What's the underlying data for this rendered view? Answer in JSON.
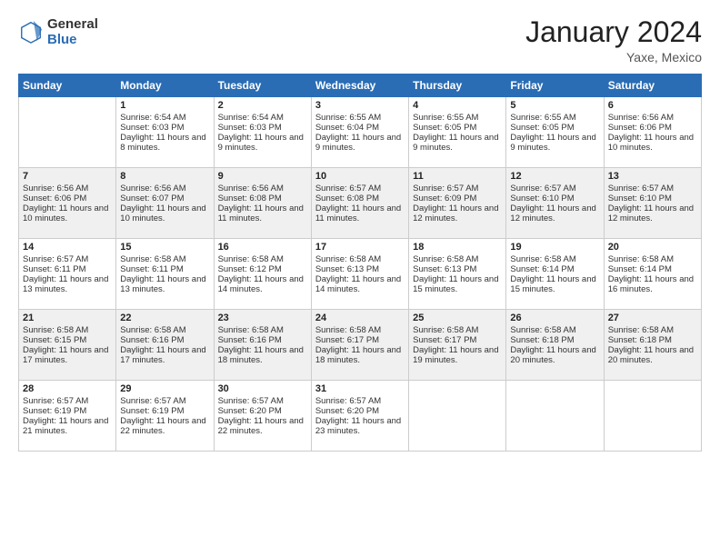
{
  "logo": {
    "general": "General",
    "blue": "Blue"
  },
  "title": "January 2024",
  "location": "Yaxe, Mexico",
  "days_header": [
    "Sunday",
    "Monday",
    "Tuesday",
    "Wednesday",
    "Thursday",
    "Friday",
    "Saturday"
  ],
  "weeks": [
    [
      {
        "day": "",
        "data": ""
      },
      {
        "day": "1",
        "sunrise": "Sunrise: 6:54 AM",
        "sunset": "Sunset: 6:03 PM",
        "daylight": "Daylight: 11 hours and 8 minutes."
      },
      {
        "day": "2",
        "sunrise": "Sunrise: 6:54 AM",
        "sunset": "Sunset: 6:03 PM",
        "daylight": "Daylight: 11 hours and 9 minutes."
      },
      {
        "day": "3",
        "sunrise": "Sunrise: 6:55 AM",
        "sunset": "Sunset: 6:04 PM",
        "daylight": "Daylight: 11 hours and 9 minutes."
      },
      {
        "day": "4",
        "sunrise": "Sunrise: 6:55 AM",
        "sunset": "Sunset: 6:05 PM",
        "daylight": "Daylight: 11 hours and 9 minutes."
      },
      {
        "day": "5",
        "sunrise": "Sunrise: 6:55 AM",
        "sunset": "Sunset: 6:05 PM",
        "daylight": "Daylight: 11 hours and 9 minutes."
      },
      {
        "day": "6",
        "sunrise": "Sunrise: 6:56 AM",
        "sunset": "Sunset: 6:06 PM",
        "daylight": "Daylight: 11 hours and 10 minutes."
      }
    ],
    [
      {
        "day": "7",
        "sunrise": "Sunrise: 6:56 AM",
        "sunset": "Sunset: 6:06 PM",
        "daylight": "Daylight: 11 hours and 10 minutes."
      },
      {
        "day": "8",
        "sunrise": "Sunrise: 6:56 AM",
        "sunset": "Sunset: 6:07 PM",
        "daylight": "Daylight: 11 hours and 10 minutes."
      },
      {
        "day": "9",
        "sunrise": "Sunrise: 6:56 AM",
        "sunset": "Sunset: 6:08 PM",
        "daylight": "Daylight: 11 hours and 11 minutes."
      },
      {
        "day": "10",
        "sunrise": "Sunrise: 6:57 AM",
        "sunset": "Sunset: 6:08 PM",
        "daylight": "Daylight: 11 hours and 11 minutes."
      },
      {
        "day": "11",
        "sunrise": "Sunrise: 6:57 AM",
        "sunset": "Sunset: 6:09 PM",
        "daylight": "Daylight: 11 hours and 12 minutes."
      },
      {
        "day": "12",
        "sunrise": "Sunrise: 6:57 AM",
        "sunset": "Sunset: 6:10 PM",
        "daylight": "Daylight: 11 hours and 12 minutes."
      },
      {
        "day": "13",
        "sunrise": "Sunrise: 6:57 AM",
        "sunset": "Sunset: 6:10 PM",
        "daylight": "Daylight: 11 hours and 12 minutes."
      }
    ],
    [
      {
        "day": "14",
        "sunrise": "Sunrise: 6:57 AM",
        "sunset": "Sunset: 6:11 PM",
        "daylight": "Daylight: 11 hours and 13 minutes."
      },
      {
        "day": "15",
        "sunrise": "Sunrise: 6:58 AM",
        "sunset": "Sunset: 6:11 PM",
        "daylight": "Daylight: 11 hours and 13 minutes."
      },
      {
        "day": "16",
        "sunrise": "Sunrise: 6:58 AM",
        "sunset": "Sunset: 6:12 PM",
        "daylight": "Daylight: 11 hours and 14 minutes."
      },
      {
        "day": "17",
        "sunrise": "Sunrise: 6:58 AM",
        "sunset": "Sunset: 6:13 PM",
        "daylight": "Daylight: 11 hours and 14 minutes."
      },
      {
        "day": "18",
        "sunrise": "Sunrise: 6:58 AM",
        "sunset": "Sunset: 6:13 PM",
        "daylight": "Daylight: 11 hours and 15 minutes."
      },
      {
        "day": "19",
        "sunrise": "Sunrise: 6:58 AM",
        "sunset": "Sunset: 6:14 PM",
        "daylight": "Daylight: 11 hours and 15 minutes."
      },
      {
        "day": "20",
        "sunrise": "Sunrise: 6:58 AM",
        "sunset": "Sunset: 6:14 PM",
        "daylight": "Daylight: 11 hours and 16 minutes."
      }
    ],
    [
      {
        "day": "21",
        "sunrise": "Sunrise: 6:58 AM",
        "sunset": "Sunset: 6:15 PM",
        "daylight": "Daylight: 11 hours and 17 minutes."
      },
      {
        "day": "22",
        "sunrise": "Sunrise: 6:58 AM",
        "sunset": "Sunset: 6:16 PM",
        "daylight": "Daylight: 11 hours and 17 minutes."
      },
      {
        "day": "23",
        "sunrise": "Sunrise: 6:58 AM",
        "sunset": "Sunset: 6:16 PM",
        "daylight": "Daylight: 11 hours and 18 minutes."
      },
      {
        "day": "24",
        "sunrise": "Sunrise: 6:58 AM",
        "sunset": "Sunset: 6:17 PM",
        "daylight": "Daylight: 11 hours and 18 minutes."
      },
      {
        "day": "25",
        "sunrise": "Sunrise: 6:58 AM",
        "sunset": "Sunset: 6:17 PM",
        "daylight": "Daylight: 11 hours and 19 minutes."
      },
      {
        "day": "26",
        "sunrise": "Sunrise: 6:58 AM",
        "sunset": "Sunset: 6:18 PM",
        "daylight": "Daylight: 11 hours and 20 minutes."
      },
      {
        "day": "27",
        "sunrise": "Sunrise: 6:58 AM",
        "sunset": "Sunset: 6:18 PM",
        "daylight": "Daylight: 11 hours and 20 minutes."
      }
    ],
    [
      {
        "day": "28",
        "sunrise": "Sunrise: 6:57 AM",
        "sunset": "Sunset: 6:19 PM",
        "daylight": "Daylight: 11 hours and 21 minutes."
      },
      {
        "day": "29",
        "sunrise": "Sunrise: 6:57 AM",
        "sunset": "Sunset: 6:19 PM",
        "daylight": "Daylight: 11 hours and 22 minutes."
      },
      {
        "day": "30",
        "sunrise": "Sunrise: 6:57 AM",
        "sunset": "Sunset: 6:20 PM",
        "daylight": "Daylight: 11 hours and 22 minutes."
      },
      {
        "day": "31",
        "sunrise": "Sunrise: 6:57 AM",
        "sunset": "Sunset: 6:20 PM",
        "daylight": "Daylight: 11 hours and 23 minutes."
      },
      {
        "day": "",
        "data": ""
      },
      {
        "day": "",
        "data": ""
      },
      {
        "day": "",
        "data": ""
      }
    ]
  ]
}
